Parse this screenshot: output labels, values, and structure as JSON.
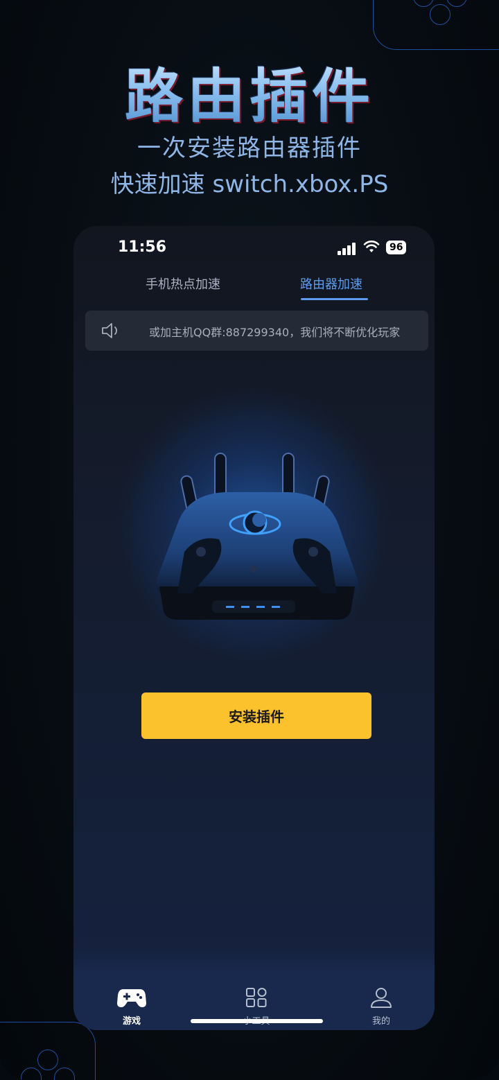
{
  "hero": {
    "title": "路由插件",
    "line1": "一次安装路由器插件",
    "line2": "快速加速 switch.xbox.PS"
  },
  "status_bar": {
    "time": "11:56",
    "battery": "96"
  },
  "tabs": [
    {
      "label": "手机热点加速",
      "active": false
    },
    {
      "label": "路由器加速",
      "active": true
    }
  ],
  "notice": {
    "icon": "speaker-icon",
    "text": "或加主机QQ群:887299340，我们将不断优化玩家"
  },
  "install_button": {
    "label": "安装插件"
  },
  "bottom_nav": [
    {
      "label": "游戏",
      "icon": "gamepad-icon",
      "active": true
    },
    {
      "label": "小工具",
      "icon": "grid-icon",
      "active": false
    },
    {
      "label": "我的",
      "icon": "user-icon",
      "active": false
    }
  ],
  "colors": {
    "accent": "#5d9bf0",
    "button": "#fbc22e",
    "background": "#070c12"
  }
}
